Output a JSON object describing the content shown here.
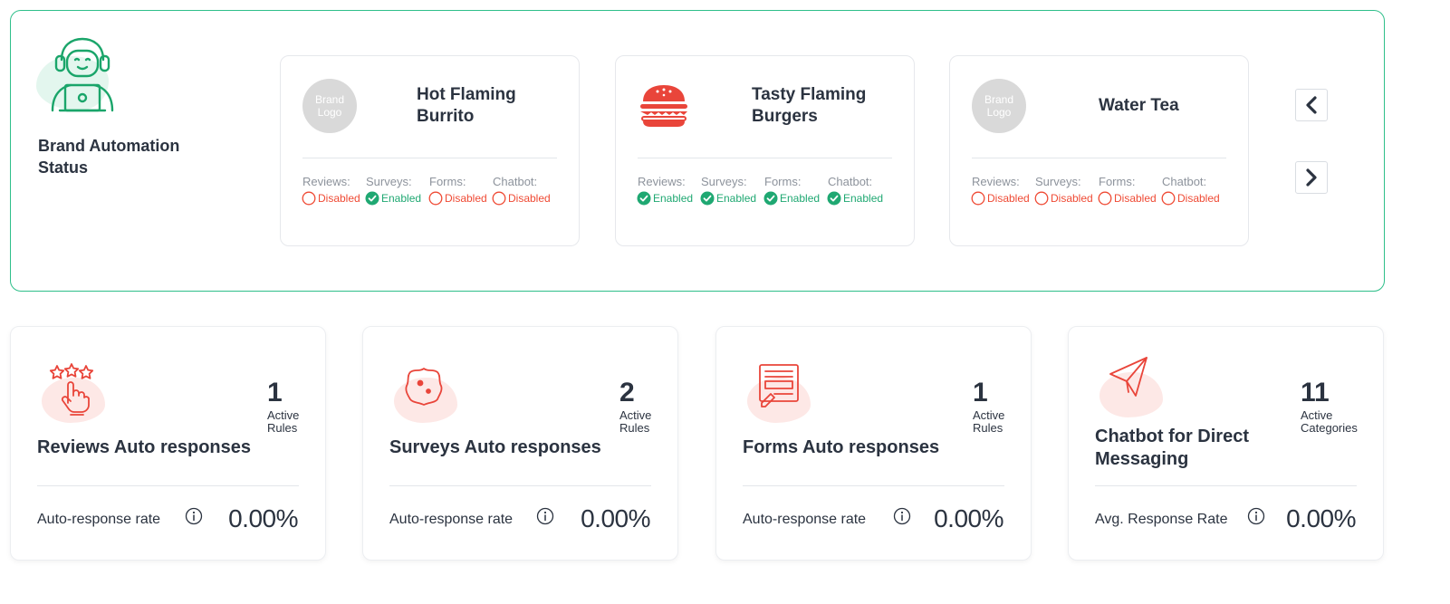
{
  "panel": {
    "title": "Brand Automation Status",
    "icon": "support-agent-icon"
  },
  "feature_labels": [
    "Reviews:",
    "Surveys:",
    "Forms:",
    "Chatbot:"
  ],
  "brands": [
    {
      "name": "Hot Flaming Burrito",
      "logo_text": "Brand Logo",
      "statuses": [
        "Disabled",
        "Enabled",
        "Disabled",
        "Disabled"
      ]
    },
    {
      "name": "Tasty Flaming Burgers",
      "logo_icon": "burger-icon",
      "statuses": [
        "Enabled",
        "Enabled",
        "Enabled",
        "Enabled"
      ]
    },
    {
      "name": "Water Tea",
      "logo_text": "Brand Logo",
      "statuses": [
        "Disabled",
        "Disabled",
        "Disabled",
        "Disabled"
      ]
    }
  ],
  "nav": {
    "prev_icon": "chevron-left-icon",
    "next_icon": "chevron-right-icon"
  },
  "cards": [
    {
      "title": "Reviews Auto responses",
      "count": "1",
      "count_label": "Active Rules",
      "rate_label": "Auto-response rate",
      "rate_value": "0.00%",
      "icon": "star-hand-icon"
    },
    {
      "title": "Surveys Auto responses",
      "count": "2",
      "count_label": "Active Rules",
      "rate_label": "Auto-response rate",
      "rate_value": "0.00%",
      "icon": "survey-badge-icon"
    },
    {
      "title": "Forms Auto responses",
      "count": "1",
      "count_label": "Active Rules",
      "rate_label": "Auto-response rate",
      "rate_value": "0.00%",
      "icon": "form-icon"
    },
    {
      "title": "Chatbot for Direct Messaging",
      "count": "11",
      "count_label": "Active Categories",
      "rate_label": "Avg. Response Rate",
      "rate_value": "0.00%",
      "icon": "paper-plane-icon"
    }
  ],
  "colors": {
    "accent_green": "#2fbf8a",
    "enabled": "#1fa872",
    "disabled": "#ef4a34",
    "icon_red": "#e9453a",
    "text_dark": "#2b3340"
  }
}
